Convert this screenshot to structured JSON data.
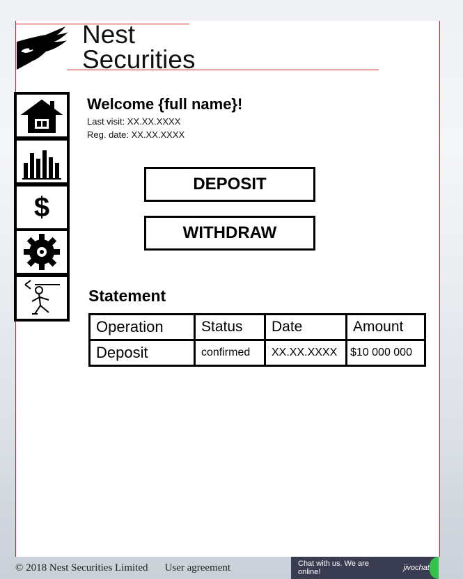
{
  "brand": {
    "line1": "Nest",
    "line2": "Securities"
  },
  "welcome": {
    "title": "Welcome {full name}!",
    "last_visit": "Last visit: XX.XX.XXXX",
    "reg_date": "Reg. date: XX.XX.XXXX"
  },
  "sidebar": {
    "items": [
      {
        "icon": "home-icon"
      },
      {
        "icon": "bar-chart-icon"
      },
      {
        "icon": "dollar-icon",
        "glyph": "$"
      },
      {
        "icon": "gear-icon"
      },
      {
        "icon": "logout-icon"
      }
    ]
  },
  "actions": {
    "deposit": "DEPOSIT",
    "withdraw": "WITHDRAW"
  },
  "statement": {
    "title": "Statement",
    "columns": [
      "Operation",
      "Status",
      "Date",
      "Amount"
    ],
    "rows": [
      {
        "operation": "Deposit",
        "status": "confirmed",
        "date": "XX.XX.XXXX",
        "amount": "$10 000 000"
      }
    ]
  },
  "footer": {
    "copyright": "© 2018 Nest Securities Limited",
    "agreement": "User agreement"
  },
  "chat": {
    "text": "Chat with us. We are online!",
    "brand": "jivochat",
    "status_color": "#35c24a"
  }
}
